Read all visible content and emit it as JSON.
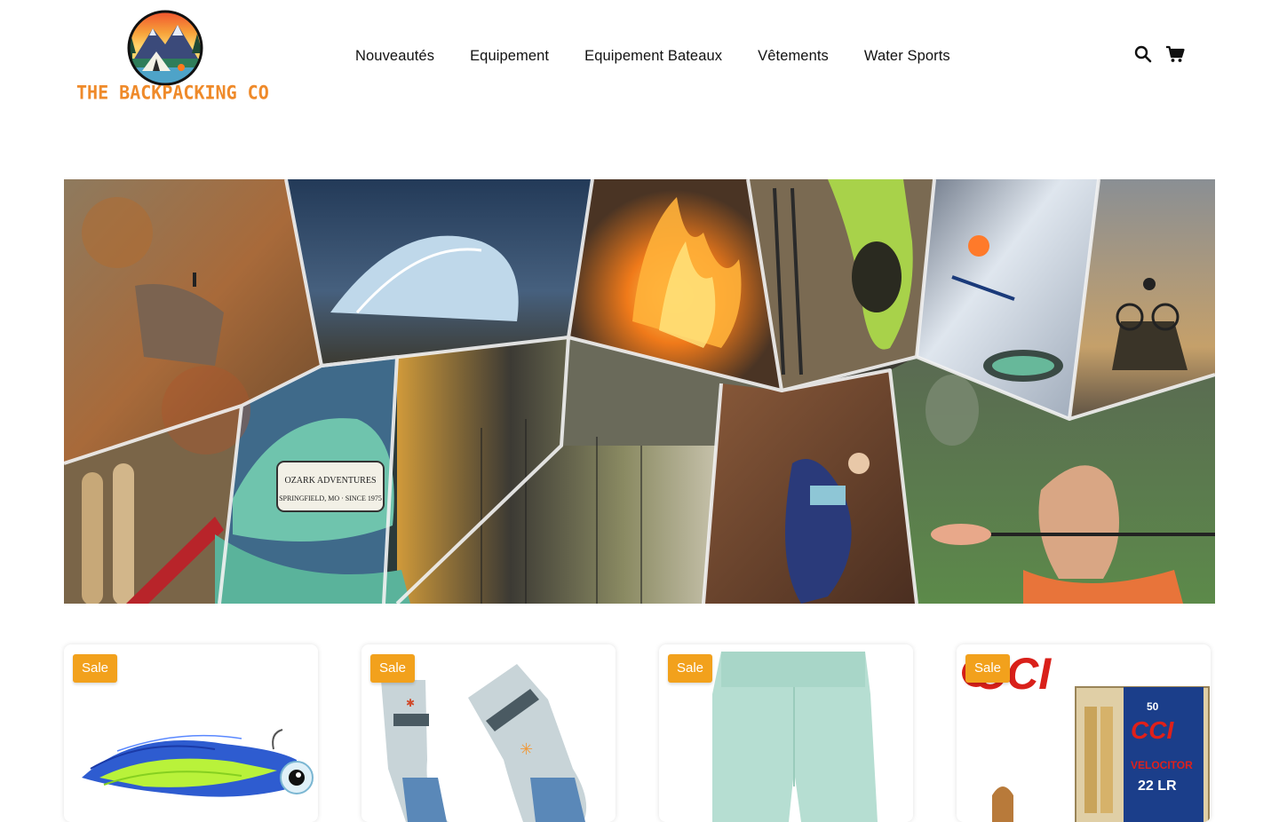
{
  "brand": {
    "name": "THE BACKPACKING CO",
    "logo_icon": "mountain-tent-campfire-logo"
  },
  "nav": {
    "items": [
      {
        "label": "Nouveautés"
      },
      {
        "label": "Equipement"
      },
      {
        "label": "Equipement Bateaux"
      },
      {
        "label": "Vêtements"
      },
      {
        "label": "Water Sports"
      }
    ]
  },
  "header_icons": {
    "search": "search-icon",
    "cart": "cart-icon"
  },
  "hero": {
    "description_icon": "outdoor-activities-collage",
    "cap_patch_line1": "OZARK ADVENTURES",
    "cap_patch_line2": "SPRINGFIELD, MO · SINCE 1975"
  },
  "products": [
    {
      "badge": "Sale",
      "image": "fishing-jig-lure"
    },
    {
      "badge": "Sale",
      "image": "hiking-socks"
    },
    {
      "badge": "Sale",
      "image": "mint-leggings"
    },
    {
      "badge": "Sale",
      "image": "cci-ammo-box",
      "ammo_brand": "CCI",
      "ammo_count": "50",
      "ammo_name": "VELOCITOR",
      "ammo_caliber": "22 LR"
    }
  ],
  "colors": {
    "accent_orange": "#ef8a2a",
    "sale_badge": "#f2a11c"
  }
}
